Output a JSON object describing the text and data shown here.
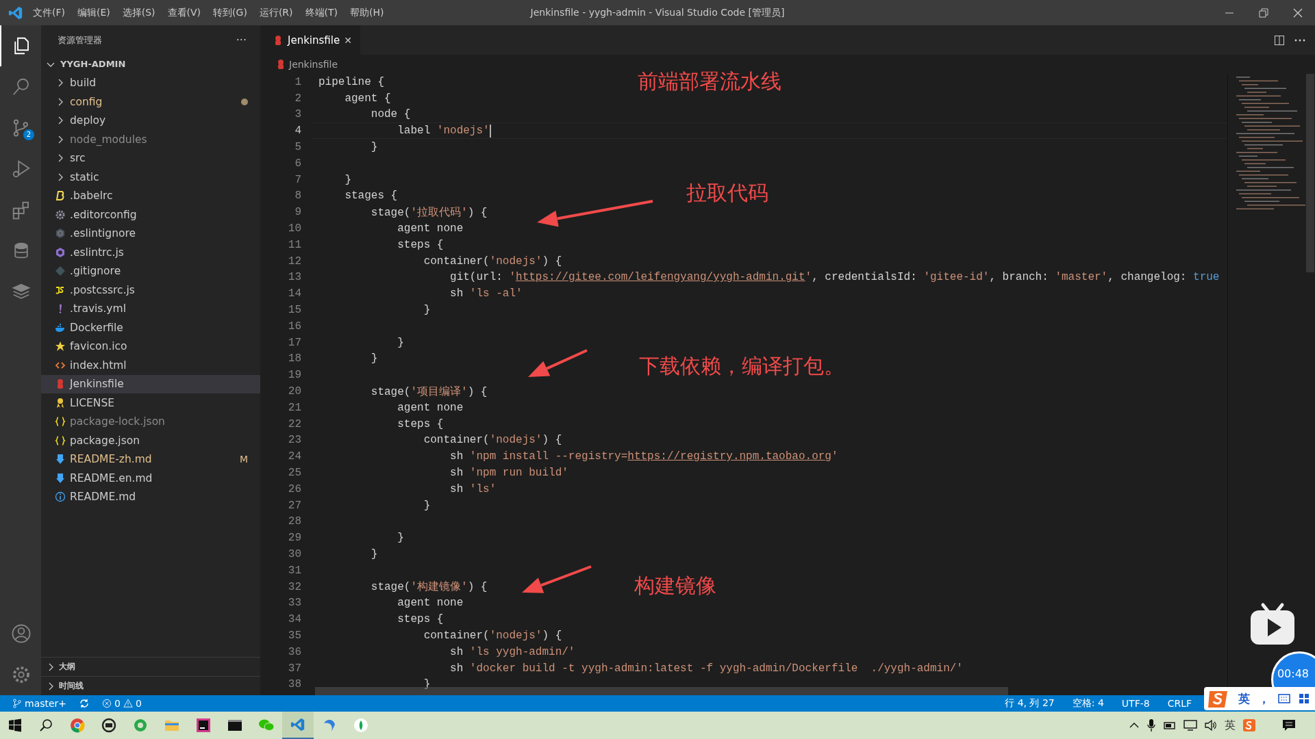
{
  "window": {
    "title": "Jenkinsfile - yygh-admin - Visual Studio Code [管理员]"
  },
  "menu": [
    "文件(F)",
    "编辑(E)",
    "选择(S)",
    "查看(V)",
    "转到(G)",
    "运行(R)",
    "终端(T)",
    "帮助(H)"
  ],
  "activity_bar": [
    {
      "kind": "explorer",
      "selected": true
    },
    {
      "kind": "search",
      "selected": false
    },
    {
      "kind": "scm",
      "selected": false,
      "badge": "2"
    },
    {
      "kind": "debug",
      "selected": false
    },
    {
      "kind": "extensions",
      "selected": false
    },
    {
      "kind": "database",
      "selected": false
    },
    {
      "kind": "layers",
      "selected": false
    }
  ],
  "sidebar": {
    "title": "资源管理器",
    "more": "···",
    "root": {
      "label": "YYGH-ADMIN",
      "expanded": true,
      "children": [
        {
          "label": "build",
          "kind": "folder",
          "expanded": false,
          "selected": false
        },
        {
          "label": "config",
          "kind": "folder",
          "expanded": false,
          "selected": false,
          "modified": true,
          "dot": true
        },
        {
          "label": "deploy",
          "kind": "folder",
          "expanded": false,
          "selected": false
        },
        {
          "label": "node_modules",
          "kind": "folder",
          "expanded": false,
          "selected": false,
          "ignored": true
        },
        {
          "label": "src",
          "kind": "folder",
          "expanded": false,
          "selected": false
        },
        {
          "label": "static",
          "kind": "folder",
          "expanded": false,
          "selected": false
        },
        {
          "label": ".babelrc",
          "kind": "babel",
          "selected": false
        },
        {
          "label": ".editorconfig",
          "kind": "gear",
          "selected": false
        },
        {
          "label": ".eslintignore",
          "kind": "eslintignore",
          "selected": false
        },
        {
          "label": ".eslintrc.js",
          "kind": "eslint",
          "selected": false
        },
        {
          "label": ".gitignore",
          "kind": "git",
          "selected": false
        },
        {
          "label": ".postcssrc.js",
          "kind": "js",
          "selected": false
        },
        {
          "label": ".travis.yml",
          "kind": "yaml",
          "selected": false
        },
        {
          "label": "Dockerfile",
          "kind": "docker",
          "selected": false
        },
        {
          "label": "favicon.ico",
          "kind": "star",
          "selected": false
        },
        {
          "label": "index.html",
          "kind": "html",
          "selected": false
        },
        {
          "label": "Jenkinsfile",
          "kind": "jenkins",
          "selected": true
        },
        {
          "label": "LICENSE",
          "kind": "license",
          "selected": false
        },
        {
          "label": "package-lock.json",
          "kind": "json",
          "selected": false,
          "ignored": true
        },
        {
          "label": "package.json",
          "kind": "json",
          "selected": false
        },
        {
          "label": "README-zh.md",
          "kind": "markdown",
          "selected": false,
          "modified": true,
          "badge": "M"
        },
        {
          "label": "README.en.md",
          "kind": "markdown",
          "selected": false
        },
        {
          "label": "README.md",
          "kind": "info",
          "selected": false
        }
      ]
    },
    "sections": [
      {
        "label": "大纲",
        "expanded": false
      },
      {
        "label": "时间线",
        "expanded": false
      }
    ]
  },
  "tabs": [
    {
      "label": "Jenkinsfile",
      "selected": true,
      "close": "✕"
    }
  ],
  "breadcrumb": "Jenkinsfile",
  "editor": {
    "lines": [
      {
        "n": "1",
        "tokens": [
          {
            "kind": "plain",
            "text": "pipeline {"
          }
        ]
      },
      {
        "n": "2",
        "tokens": [
          {
            "kind": "plain",
            "text": "    agent {"
          }
        ]
      },
      {
        "n": "3",
        "tokens": [
          {
            "kind": "plain",
            "text": "        node {"
          }
        ]
      },
      {
        "n": "4",
        "current": true,
        "tokens": [
          {
            "kind": "plain",
            "text": "            label "
          },
          {
            "kind": "string",
            "text": "'nodejs'"
          }
        ]
      },
      {
        "n": "5",
        "tokens": [
          {
            "kind": "plain",
            "text": "        }"
          }
        ]
      },
      {
        "n": "6"
      },
      {
        "n": "7",
        "tokens": [
          {
            "kind": "plain",
            "text": "    }"
          }
        ]
      },
      {
        "n": "8",
        "tokens": [
          {
            "kind": "plain",
            "text": "    stages {"
          }
        ]
      },
      {
        "n": "9",
        "tokens": [
          {
            "kind": "plain",
            "text": "        stage("
          },
          {
            "kind": "string",
            "text": "'拉取代码'"
          },
          {
            "kind": "plain",
            "text": ") {"
          }
        ]
      },
      {
        "n": "10",
        "tokens": [
          {
            "kind": "plain",
            "text": "            agent none"
          }
        ]
      },
      {
        "n": "11",
        "tokens": [
          {
            "kind": "plain",
            "text": "            steps {"
          }
        ]
      },
      {
        "n": "12",
        "tokens": [
          {
            "kind": "plain",
            "text": "                container("
          },
          {
            "kind": "string",
            "text": "'nodejs'"
          },
          {
            "kind": "plain",
            "text": ") {"
          }
        ]
      },
      {
        "n": "13",
        "tokens": [
          {
            "kind": "plain",
            "text": "                    git(url: "
          },
          {
            "kind": "string",
            "text": "'"
          },
          {
            "kind": "link",
            "text": "https://gitee.com/leifengyang/yygh-admin.git"
          },
          {
            "kind": "string",
            "text": "'"
          },
          {
            "kind": "plain",
            "text": ", credentialsId: "
          },
          {
            "kind": "string",
            "text": "'gitee-id'"
          },
          {
            "kind": "plain",
            "text": ", branch: "
          },
          {
            "kind": "string",
            "text": "'master'"
          },
          {
            "kind": "plain",
            "text": ", changelog: "
          },
          {
            "kind": "keyword",
            "text": "true"
          }
        ]
      },
      {
        "n": "14",
        "tokens": [
          {
            "kind": "plain",
            "text": "                    sh "
          },
          {
            "kind": "string",
            "text": "'ls -al'"
          }
        ]
      },
      {
        "n": "15",
        "tokens": [
          {
            "kind": "plain",
            "text": "                }"
          }
        ]
      },
      {
        "n": "16"
      },
      {
        "n": "17",
        "tokens": [
          {
            "kind": "plain",
            "text": "            }"
          }
        ]
      },
      {
        "n": "18",
        "tokens": [
          {
            "kind": "plain",
            "text": "        }"
          }
        ]
      },
      {
        "n": "19"
      },
      {
        "n": "20",
        "tokens": [
          {
            "kind": "plain",
            "text": "        stage("
          },
          {
            "kind": "string",
            "text": "'项目编译'"
          },
          {
            "kind": "plain",
            "text": ") {"
          }
        ]
      },
      {
        "n": "21",
        "tokens": [
          {
            "kind": "plain",
            "text": "            agent none"
          }
        ]
      },
      {
        "n": "22",
        "tokens": [
          {
            "kind": "plain",
            "text": "            steps {"
          }
        ]
      },
      {
        "n": "23",
        "tokens": [
          {
            "kind": "plain",
            "text": "                container("
          },
          {
            "kind": "string",
            "text": "'nodejs'"
          },
          {
            "kind": "plain",
            "text": ") {"
          }
        ]
      },
      {
        "n": "24",
        "tokens": [
          {
            "kind": "plain",
            "text": "                    sh "
          },
          {
            "kind": "string",
            "text": "'npm install --registry="
          },
          {
            "kind": "link",
            "text": "https://registry.npm.taobao.org"
          },
          {
            "kind": "string",
            "text": "'"
          }
        ]
      },
      {
        "n": "25",
        "tokens": [
          {
            "kind": "plain",
            "text": "                    sh "
          },
          {
            "kind": "string",
            "text": "'npm run build'"
          }
        ]
      },
      {
        "n": "26",
        "tokens": [
          {
            "kind": "plain",
            "text": "                    sh "
          },
          {
            "kind": "string",
            "text": "'ls'"
          }
        ]
      },
      {
        "n": "27",
        "tokens": [
          {
            "kind": "plain",
            "text": "                }"
          }
        ]
      },
      {
        "n": "28"
      },
      {
        "n": "29",
        "tokens": [
          {
            "kind": "plain",
            "text": "            }"
          }
        ]
      },
      {
        "n": "30",
        "tokens": [
          {
            "kind": "plain",
            "text": "        }"
          }
        ]
      },
      {
        "n": "31"
      },
      {
        "n": "32",
        "tokens": [
          {
            "kind": "plain",
            "text": "        stage("
          },
          {
            "kind": "string",
            "text": "'构建镜像'"
          },
          {
            "kind": "plain",
            "text": ") {"
          }
        ]
      },
      {
        "n": "33",
        "tokens": [
          {
            "kind": "plain",
            "text": "            agent none"
          }
        ]
      },
      {
        "n": "34",
        "tokens": [
          {
            "kind": "plain",
            "text": "            steps {"
          }
        ]
      },
      {
        "n": "35",
        "tokens": [
          {
            "kind": "plain",
            "text": "                container("
          },
          {
            "kind": "string",
            "text": "'nodejs'"
          },
          {
            "kind": "plain",
            "text": ") {"
          }
        ]
      },
      {
        "n": "36",
        "tokens": [
          {
            "kind": "plain",
            "text": "                    sh "
          },
          {
            "kind": "string",
            "text": "'ls yygh-admin/'"
          }
        ]
      },
      {
        "n": "37",
        "tokens": [
          {
            "kind": "plain",
            "text": "                    sh "
          },
          {
            "kind": "string",
            "text": "'docker build -t yygh-admin:latest -f yygh-admin/Dockerfile  ./yygh-admin/'"
          }
        ]
      },
      {
        "n": "38",
        "tokens": [
          {
            "kind": "plain",
            "text": "                }"
          }
        ]
      }
    ]
  },
  "annotations": [
    {
      "text": "前端部署流水线",
      "arrow": false
    },
    {
      "text": "拉取代码",
      "arrow": true
    },
    {
      "text": "下载依赖，编译打包。",
      "arrow": true
    },
    {
      "text": "构建镜像",
      "arrow": true
    }
  ],
  "video_overlay": {
    "time": "00:48"
  },
  "status_bar": {
    "branch": "master+",
    "errors": "0",
    "warnings": "0",
    "position": "行 4, 列 27",
    "indent": "空格: 4",
    "encoding": "UTF-8",
    "eol": "CRLF"
  },
  "ime": {
    "mode": "英",
    "punct": "，"
  },
  "taskbar": {
    "tray_ime": "英"
  }
}
